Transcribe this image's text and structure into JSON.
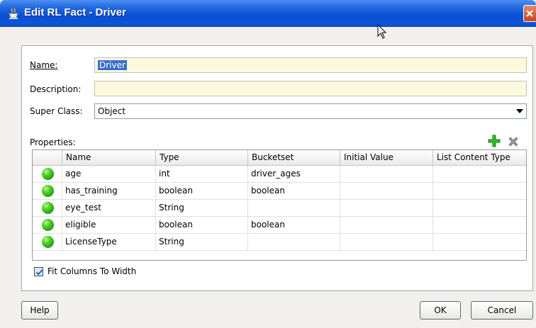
{
  "window": {
    "title": "Edit RL Fact - Driver"
  },
  "form": {
    "name_label": "Name:",
    "name_value": "Driver",
    "description_label": "Description:",
    "description_value": "",
    "superclass_label": "Super Class:",
    "superclass_value": "Object",
    "properties_label": "Properties:"
  },
  "table": {
    "columns": [
      "Name",
      "Type",
      "Bucketset",
      "Initial Value",
      "List Content Type"
    ],
    "rows": [
      {
        "name": "age",
        "type": "int",
        "bucketset": "driver_ages",
        "initial": "",
        "list_type": ""
      },
      {
        "name": "has_training",
        "type": "boolean",
        "bucketset": "boolean",
        "initial": "",
        "list_type": ""
      },
      {
        "name": "eye_test",
        "type": "String",
        "bucketset": "",
        "initial": "",
        "list_type": ""
      },
      {
        "name": "eligible",
        "type": "boolean",
        "bucketset": "boolean",
        "initial": "",
        "list_type": ""
      },
      {
        "name": "LicenseType",
        "type": "String",
        "bucketset": "",
        "initial": "",
        "list_type": ""
      }
    ]
  },
  "options": {
    "fit_columns_label": "Fit Columns To Width",
    "fit_columns_checked": true
  },
  "buttons": {
    "help": "Help",
    "ok": "OK",
    "cancel": "Cancel"
  },
  "colors": {
    "titlebar": "#0a4fd2",
    "field_bg": "#fbfade",
    "status_ball": "#4fcf2a"
  },
  "icons": [
    "coffee-cup-icon",
    "close-icon",
    "add-icon",
    "delete-icon",
    "status-ball-icon",
    "checkmark-icon"
  ]
}
